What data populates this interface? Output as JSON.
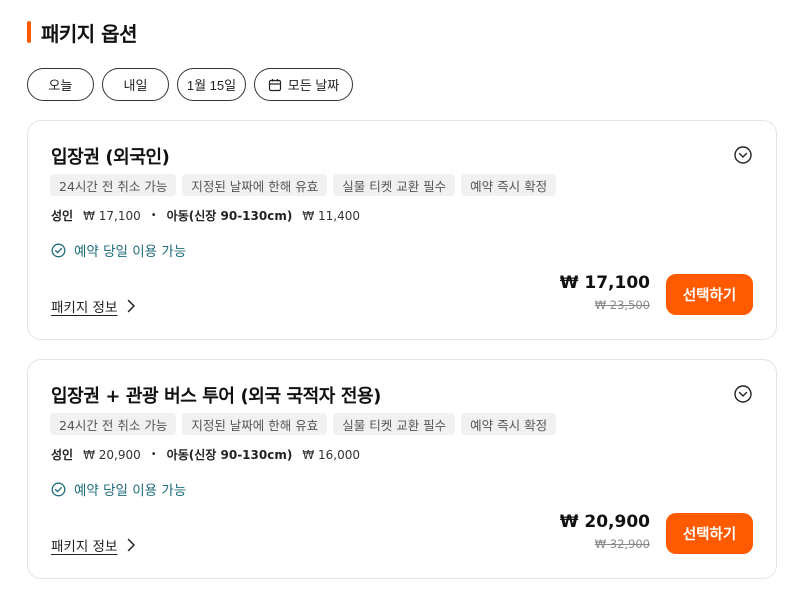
{
  "section": {
    "title": "패키지 옵션",
    "accent_color": "#ff5a00"
  },
  "date_chips": [
    {
      "label": "오늘"
    },
    {
      "label": "내일"
    },
    {
      "label": "1월 15일"
    },
    {
      "label": "모든 날짜",
      "icon": "calendar-icon"
    }
  ],
  "packages": [
    {
      "title": "입장권 (외국인)",
      "tags": [
        "24시간 전 취소 가능",
        "지정된 날짜에 한해 유효",
        "실물 티켓 교환 필수",
        "예약 즉시 확정"
      ],
      "adult_label": "성인",
      "adult_price": "₩ 17,100",
      "child_label": "아동(신장 90-130cm)",
      "child_price": "₩ 11,400",
      "availability": "예약 당일 이용 가능",
      "info_label": "패키지 정보",
      "price": "₩ 17,100",
      "original_price": "₩ 23,500",
      "button_label": "선택하기"
    },
    {
      "title": "입장권 + 관광 버스 투어 (외국 국적자 전용)",
      "tags": [
        "24시간 전 취소 가능",
        "지정된 날짜에 한해 유효",
        "실물 티켓 교환 필수",
        "예약 즉시 확정"
      ],
      "adult_label": "성인",
      "adult_price": "₩ 20,900",
      "child_label": "아동(신장 90-130cm)",
      "child_price": "₩ 16,000",
      "availability": "예약 당일 이용 가능",
      "info_label": "패키지 정보",
      "price": "₩ 20,900",
      "original_price": "₩ 32,900",
      "button_label": "선택하기"
    }
  ]
}
